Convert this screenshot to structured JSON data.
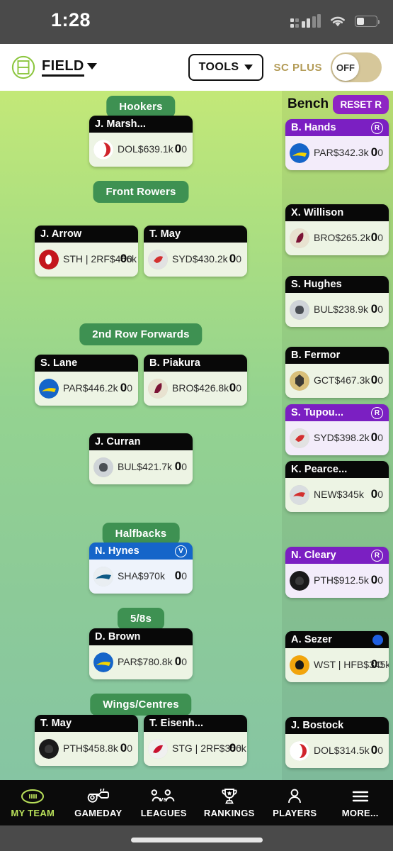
{
  "status_bar": {
    "time": "1:28",
    "signal_icon": "cellular-signal-icon",
    "wifi_icon": "wifi-icon",
    "battery_icon": "battery-icon"
  },
  "header": {
    "brand_icon": "field-pitch-icon",
    "brand_label": "FIELD",
    "brand_chevron_icon": "chevron-down-icon",
    "tools_label": "TOOLS",
    "tools_chevron_icon": "chevron-down-icon",
    "sc_plus_label": "SC PLUS",
    "toggle_state": "OFF"
  },
  "field": {
    "positions": [
      {
        "label": "Hookers"
      },
      {
        "label": "Front Rowers"
      },
      {
        "label": "2nd Row Forwards"
      },
      {
        "label": "Halfbacks"
      },
      {
        "label": "5/8s"
      },
      {
        "label": "Wings/Centres"
      }
    ],
    "players": [
      {
        "name": "J. Marsh...",
        "team": "DOL",
        "price": "$639.1k",
        "score": "0",
        "sub": "0",
        "status": "normal",
        "badge": "",
        "logo": "dolphins-logo-icon"
      },
      {
        "name": "J. Arrow",
        "team": "STH | 2RF",
        "price": "$466k",
        "score": "0",
        "sub": "0",
        "status": "normal",
        "badge": "",
        "logo": "rabbitohs-logo-icon"
      },
      {
        "name": "T. May",
        "team": "SYD",
        "price": "$430.2k",
        "score": "0",
        "sub": "0",
        "status": "normal",
        "badge": "",
        "logo": "roosters-logo-icon"
      },
      {
        "name": "S. Lane",
        "team": "PAR",
        "price": "$446.2k",
        "score": "0",
        "sub": "0",
        "status": "normal",
        "badge": "",
        "logo": "eels-logo-icon"
      },
      {
        "name": "B. Piakura",
        "team": "BRO",
        "price": "$426.8k",
        "score": "0",
        "sub": "0",
        "status": "normal",
        "badge": "",
        "logo": "broncos-logo-icon"
      },
      {
        "name": "J. Curran",
        "team": "BUL",
        "price": "$421.7k",
        "score": "0",
        "sub": "0",
        "status": "normal",
        "badge": "",
        "logo": "bulldogs-logo-icon"
      },
      {
        "name": "N. Hynes",
        "team": "SHA",
        "price": "$970k",
        "score": "0",
        "sub": "0",
        "status": "captain",
        "badge": "V",
        "logo": "sharks-logo-icon"
      },
      {
        "name": "D. Brown",
        "team": "PAR",
        "price": "$780.8k",
        "score": "0",
        "sub": "0",
        "status": "normal",
        "badge": "",
        "logo": "eels-logo-icon"
      },
      {
        "name": "T. May",
        "team": "PTH",
        "price": "$458.8k",
        "score": "0",
        "sub": "0",
        "status": "normal",
        "badge": "",
        "logo": "panthers-logo-icon"
      },
      {
        "name": "T. Eisenh...",
        "team": "STG | 2RF",
        "price": "$356k",
        "score": "0",
        "sub": "0",
        "status": "normal",
        "badge": "",
        "logo": "dragons-logo-icon"
      }
    ]
  },
  "bench": {
    "title": "Bench",
    "reset_label": "RESET R",
    "players": [
      {
        "name": "B. Hands",
        "team": "PAR",
        "price": "$342.3k",
        "score": "0",
        "sub": "0",
        "status": "reserve",
        "badge": "R",
        "logo": "eels-logo-icon"
      },
      {
        "name": "X. Willison",
        "team": "BRO",
        "price": "$265.2k",
        "score": "0",
        "sub": "0",
        "status": "normal",
        "badge": "",
        "logo": "broncos-logo-icon"
      },
      {
        "name": "S. Hughes",
        "team": "BUL",
        "price": "$238.9k",
        "score": "0",
        "sub": "0",
        "status": "normal",
        "badge": "",
        "logo": "bulldogs-logo-icon"
      },
      {
        "name": "B. Fermor",
        "team": "GCT",
        "price": "$467.3k",
        "score": "0",
        "sub": "0",
        "status": "normal",
        "badge": "",
        "logo": "titans-logo-icon"
      },
      {
        "name": "S. Tupou...",
        "team": "SYD",
        "price": "$398.2k",
        "score": "0",
        "sub": "0",
        "status": "reserve",
        "badge": "R",
        "logo": "roosters-logo-icon"
      },
      {
        "name": "K. Pearce...",
        "team": "NEW",
        "price": "$345k",
        "score": "0",
        "sub": "0",
        "status": "normal",
        "badge": "",
        "logo": "knights-logo-icon"
      },
      {
        "name": "N. Cleary",
        "team": "PTH",
        "price": "$912.5k",
        "score": "0",
        "sub": "0",
        "status": "reserve",
        "badge": "R",
        "logo": "panthers-logo-icon"
      },
      {
        "name": "A. Sezer",
        "team": "WST | HFB",
        "price": "$345k",
        "score": "0",
        "sub": "0",
        "status": "normal",
        "badge": "dot",
        "logo": "tigers-logo-icon"
      },
      {
        "name": "J. Bostock",
        "team": "DOL",
        "price": "$314.5k",
        "score": "0",
        "sub": "0",
        "status": "normal",
        "badge": "",
        "logo": "dolphins-logo-icon"
      }
    ]
  },
  "tabbar": {
    "items": [
      {
        "label": "MY TEAM",
        "icon": "football-icon",
        "active": true
      },
      {
        "label": "GAMEDAY",
        "icon": "whistle-icon",
        "active": false
      },
      {
        "label": "LEAGUES",
        "icon": "versus-people-icon",
        "active": false
      },
      {
        "label": "RANKINGS",
        "icon": "trophy-icon",
        "active": false
      },
      {
        "label": "PLAYERS",
        "icon": "person-icon",
        "active": false
      },
      {
        "label": "MORE...",
        "icon": "hamburger-icon",
        "active": false
      }
    ]
  },
  "colors": {
    "accent_green": "#b9e05a",
    "position_green": "#3e9152",
    "reserve_purple": "#7b1fc2",
    "captain_blue": "#1565c9",
    "gold": "#b39b56"
  }
}
